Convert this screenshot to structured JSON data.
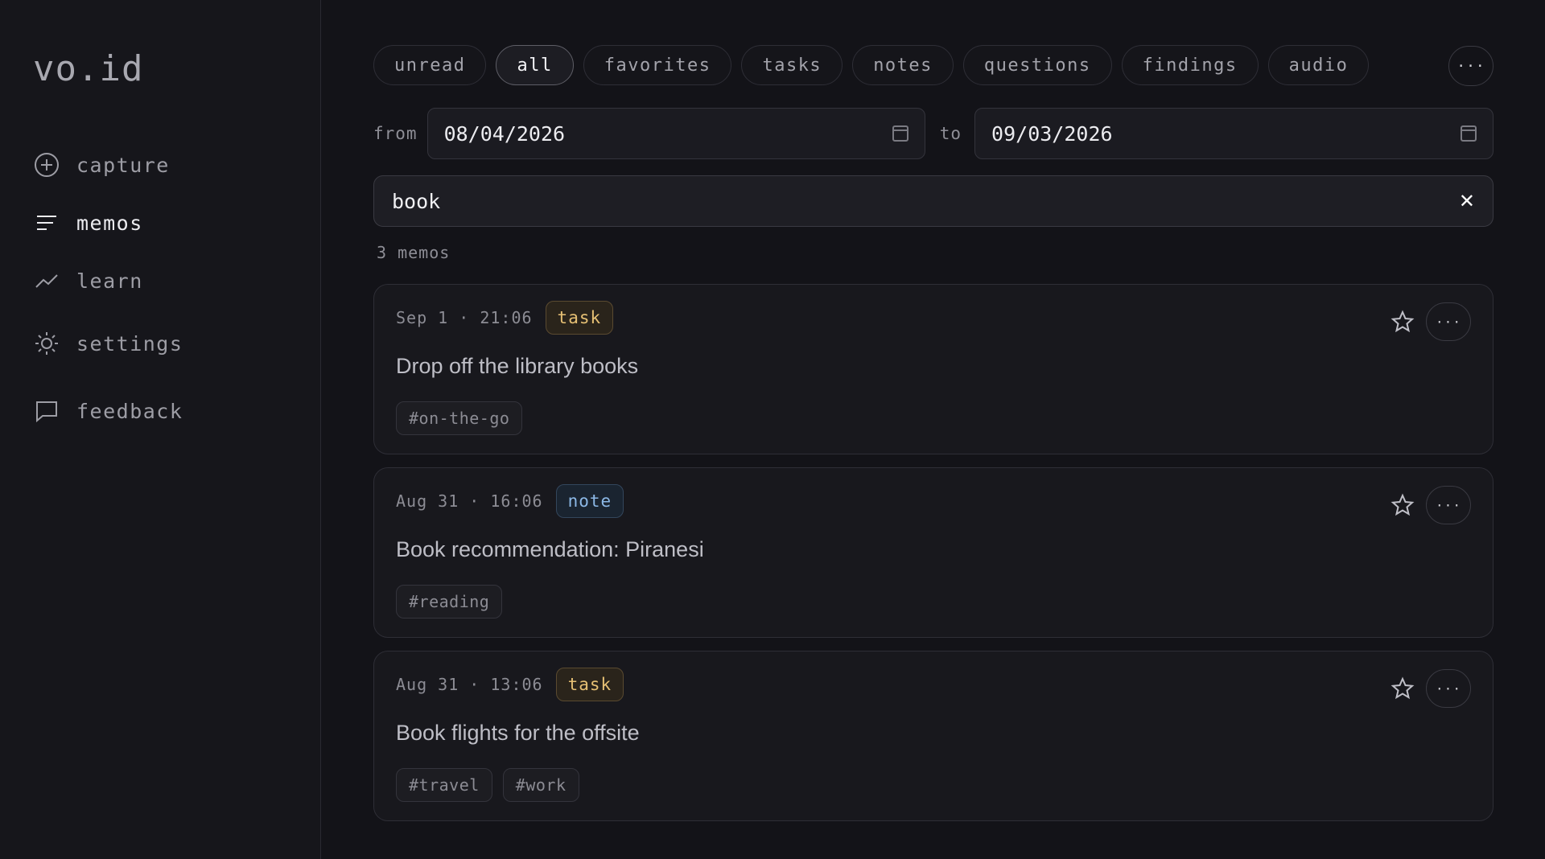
{
  "app": {
    "logo": "vo.id"
  },
  "sidebar": {
    "items": [
      {
        "label": "capture",
        "icon": "plus-circle-icon"
      },
      {
        "label": "memos",
        "icon": "lines-icon",
        "active": true
      },
      {
        "label": "learn",
        "icon": "trend-icon"
      },
      {
        "label": "settings",
        "icon": "gear-icon"
      },
      {
        "label": "feedback",
        "icon": "chat-icon"
      }
    ]
  },
  "filters": {
    "chips": [
      "unread",
      "all",
      "favorites",
      "tasks",
      "notes",
      "questions",
      "findings",
      "audio"
    ],
    "active": "all",
    "more_label": "···"
  },
  "dates": {
    "from_label": "from",
    "from_value": "08/04/2026",
    "to_label": "to",
    "to_value": "09/03/2026"
  },
  "search": {
    "value": "book",
    "clear_label": "✕"
  },
  "results": {
    "count_label": "3 memos"
  },
  "memos": [
    {
      "time": "Sep 1 · 21:06",
      "type": "task",
      "title": "Drop off the library books",
      "tags": [
        "#on-the-go"
      ]
    },
    {
      "time": "Aug 31 · 16:06",
      "type": "note",
      "title": "Book recommendation: Piranesi",
      "tags": [
        "#reading"
      ]
    },
    {
      "time": "Aug 31 · 13:06",
      "type": "task",
      "title": "Book flights for the offsite",
      "tags": [
        "#travel",
        "#work"
      ]
    }
  ],
  "colors": {
    "task": "#e6c074",
    "note": "#8cb8e6",
    "background": "#131318"
  },
  "card_more_label": "···"
}
